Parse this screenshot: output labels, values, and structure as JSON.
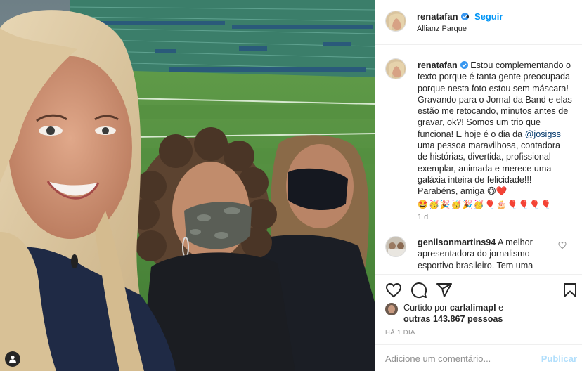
{
  "post": {
    "username": "renatafan",
    "verified": true,
    "follow_label": "Seguir",
    "separator": "•",
    "location": "Allianz Parque"
  },
  "caption": {
    "username": "renatafan",
    "text_before": "Estou complementando o texto porque é tanta gente preocupada porque nesta foto estou sem máscara! Gravando para o Jornal da Band e elas estão me retocando, minutos antes de gravar, ok?! Somos um trio que funciona! E hoje é o dia da ",
    "mention": "@josigss",
    "text_after": " uma pessoa maravilhosa, contadora de histórias, divertida, profissional exemplar, animada e merece uma galáxia inteira de felicidade!!! Parabéns, amiga 😋❤️",
    "emoji_line": "🤩🥳🎉🥳🎉🥳🎈🎂🎈🎈🎈🎈",
    "time": "1 d"
  },
  "comment": {
    "username": "genilsonmartins94",
    "text": "A melhor apresentadora do jornalismo esportivo brasileiro. Tem uma"
  },
  "actions": {
    "like": "heart-icon",
    "comment": "comment-icon",
    "share": "share-icon",
    "save": "bookmark-icon"
  },
  "likes": {
    "prefix": "Curtido por ",
    "user": "carlalimapl",
    "middle": " e",
    "others": "outras 143.867 pessoas"
  },
  "date": "HÁ 1 DIA",
  "add_comment": {
    "placeholder": "Adicione um comentário...",
    "publish_label": "Publicar"
  },
  "colors": {
    "link_blue": "#0095f6",
    "mention_blue": "#00376b",
    "muted": "#8e8e8e",
    "publish_disabled": "#b2dffc"
  }
}
